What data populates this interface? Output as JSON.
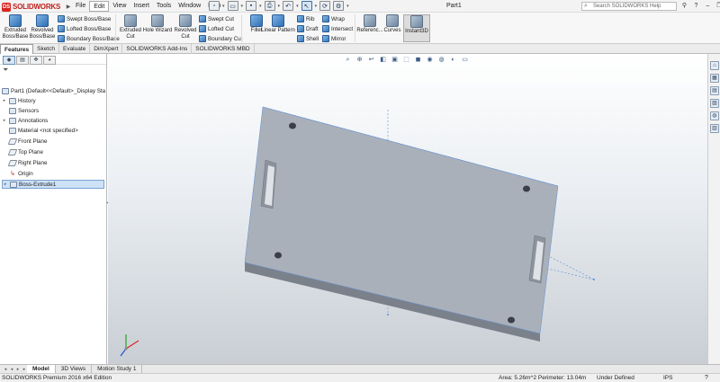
{
  "app": {
    "brand": "SOLIDWORKS",
    "logo_mark": "DS",
    "document_title": "Part1",
    "accent_color": "#d8241f"
  },
  "menu": {
    "items": [
      "File",
      "Edit",
      "View",
      "Insert",
      "Tools",
      "Window",
      "Help"
    ],
    "active": "Edit"
  },
  "quickbar": {
    "icons": [
      "new-icon",
      "open-icon",
      "save-icon",
      "print-icon",
      "undo-icon",
      "select-icon",
      "rebuild-icon",
      "options-icon"
    ]
  },
  "help_search": {
    "placeholder": "Search SOLIDWORKS Help"
  },
  "ribbon": {
    "extruded_boss": "Extruded Boss/Base",
    "revolved_boss": "Revolved Boss/Base",
    "swept_boss": "Swept Boss/Base",
    "lofted_boss": "Lofted Boss/Base",
    "boundary_boss": "Boundary Boss/Base",
    "extruded_cut": "Extruded Cut",
    "hole_wizard": "Hole Wizard",
    "revolved_cut": "Revolved Cut",
    "swept_cut": "Swept Cut",
    "lofted_cut": "Lofted Cut",
    "boundary_cut": "Boundary Cut",
    "fillet": "Fillet",
    "linear_pattern": "Linear Pattern",
    "rib": "Rib",
    "draft": "Draft",
    "shell": "Shell",
    "wrap": "Wrap",
    "intersect": "Intersect",
    "mirror": "Mirror",
    "reference": "Referenc...",
    "curves": "Curves",
    "instant3d": "Instant3D"
  },
  "command_tabs": {
    "items": [
      "Features",
      "Sketch",
      "Evaluate",
      "DimXpert",
      "SOLIDWORKS Add-Ins",
      "SOLIDWORKS MBD"
    ],
    "active": "Features"
  },
  "feature_tree": {
    "root": "Part1  (Default<<Default>_Display Sta",
    "items": [
      {
        "label": "History",
        "icon": "history-icon",
        "expandable": true
      },
      {
        "label": "Sensors",
        "icon": "sensors-icon",
        "expandable": false
      },
      {
        "label": "Annotations",
        "icon": "annotations-icon",
        "expandable": true
      },
      {
        "label": "Material <not specified>",
        "icon": "material-icon",
        "expandable": false
      },
      {
        "label": "Front Plane",
        "icon": "plane-icon",
        "expandable": false
      },
      {
        "label": "Top Plane",
        "icon": "plane-icon",
        "expandable": false
      },
      {
        "label": "Right Plane",
        "icon": "plane-icon",
        "expandable": false
      },
      {
        "label": "Origin",
        "icon": "origin-icon",
        "expandable": false
      },
      {
        "label": "Boss-Extrude1",
        "icon": "extrude-icon",
        "expandable": true,
        "selected": true
      }
    ]
  },
  "viewport": {
    "background_top": "#ffffff",
    "background_bottom": "#c9ced4",
    "part_color": "#a9afb8"
  },
  "bottom_tabs": {
    "items": [
      "Model",
      "3D Views",
      "Motion Study 1"
    ],
    "active": "Model"
  },
  "status": {
    "edition": "SOLIDWORKS Premium 2016 x64 Edition",
    "measure": "Area: 5.26m^2 Perimeter: 13.04m",
    "state": "Under Defined",
    "units": "IPS",
    "help": "?"
  }
}
